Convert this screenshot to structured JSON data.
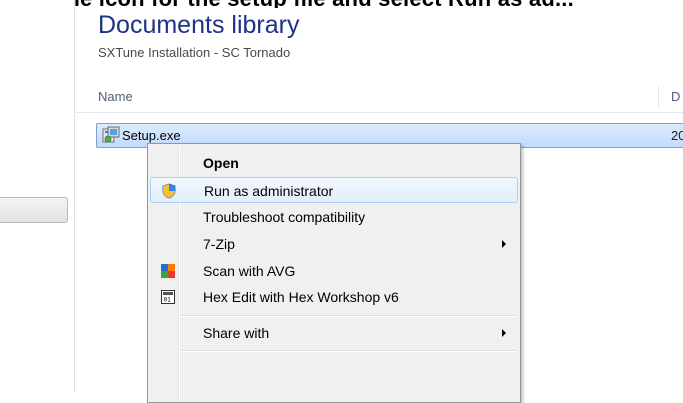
{
  "top_caption": "...ing the icon for the setup file and select Run as ad...",
  "library": {
    "title": "Documents library",
    "subtitle": "SXTune Installation - SC Tornado"
  },
  "columns": {
    "name": "Name",
    "date": "D"
  },
  "file": {
    "name": "Setup.exe",
    "date": "20",
    "icon": "installer-icon"
  },
  "context_menu": {
    "items": [
      {
        "label": "Open",
        "bold": true
      },
      {
        "label": "Run as administrator",
        "icon": "uac-shield-icon",
        "highlighted": true
      },
      {
        "label": "Troubleshoot compatibility"
      },
      {
        "label": "7-Zip",
        "submenu": true
      },
      {
        "label": "Scan with AVG",
        "icon": "avg-icon"
      },
      {
        "label": "Hex Edit with Hex Workshop v6",
        "icon": "hex-workshop-icon"
      },
      {
        "label": "Share with",
        "submenu": true
      }
    ]
  },
  "colors": {
    "title": "#1e3287",
    "selection": "#c1dbfc",
    "menu_bg": "#f0f0f0"
  }
}
